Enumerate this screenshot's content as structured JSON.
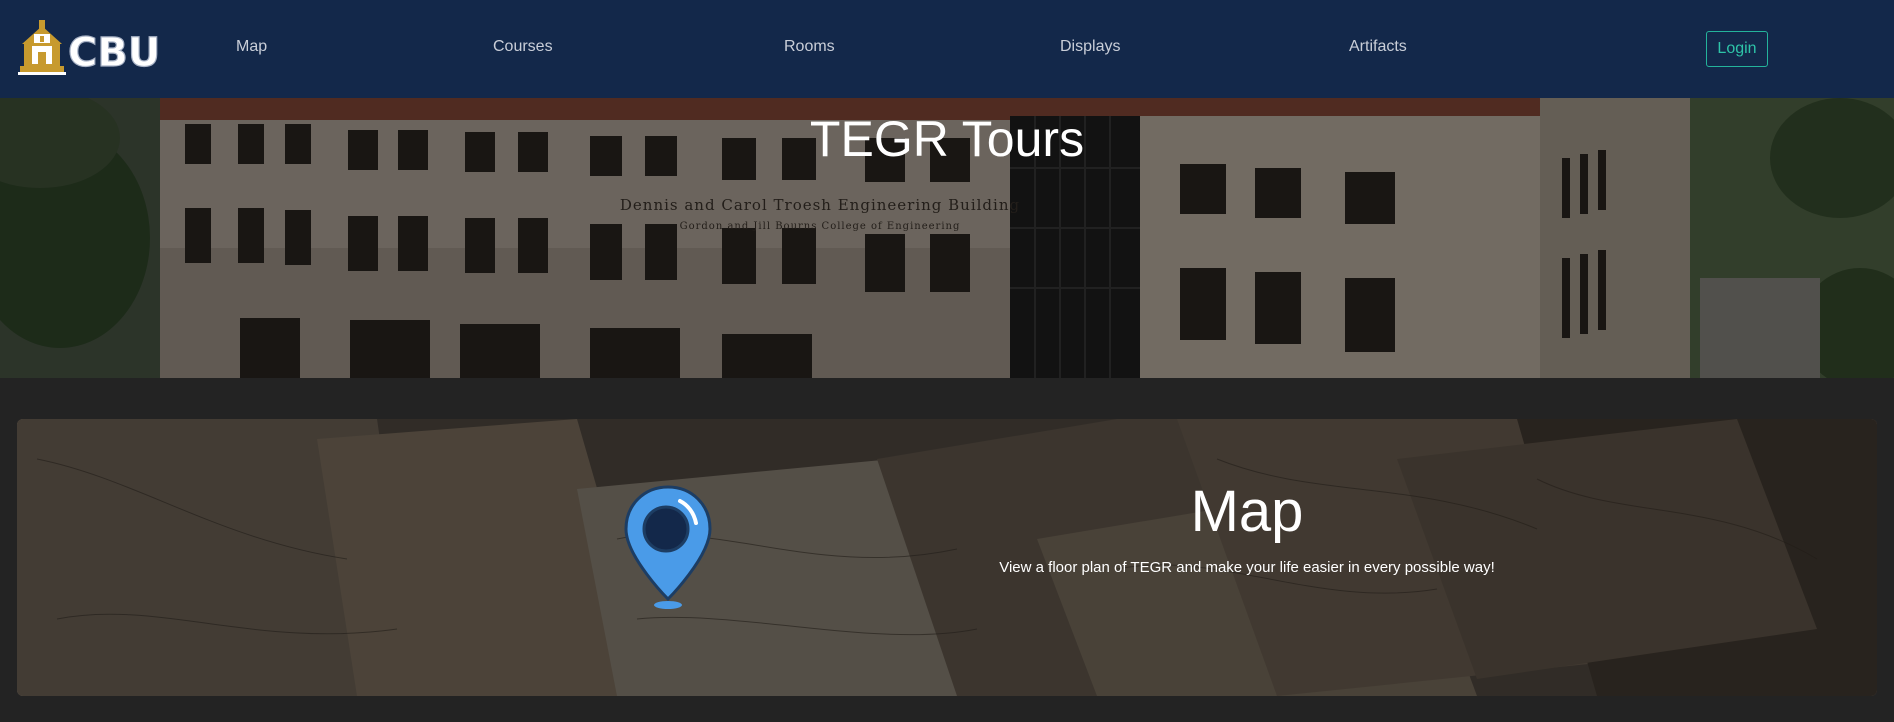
{
  "brand": {
    "text": "CBU",
    "logo_icon": "bell-tower-icon",
    "accent": "#c79a2e"
  },
  "nav": {
    "items": [
      {
        "label": "Map"
      },
      {
        "label": "Courses"
      },
      {
        "label": "Rooms"
      },
      {
        "label": "Displays"
      },
      {
        "label": "Artifacts"
      }
    ],
    "login_label": "Login"
  },
  "hero": {
    "title": "TEGR Tours",
    "building_sign_line1": "Dennis and Carol Troesh Engineering Building",
    "building_sign_line2": "Gordon and Jill Bourns College of Engineering"
  },
  "card": {
    "title": "Map",
    "description": "View a floor plan of TEGR and make your life easier in every possible way!",
    "icon": "map-pin-icon"
  },
  "colors": {
    "navbar_bg": "#13284a",
    "page_bg": "#232323",
    "login_accent": "#2ec4a8",
    "pin_blue": "#4a9be8"
  }
}
